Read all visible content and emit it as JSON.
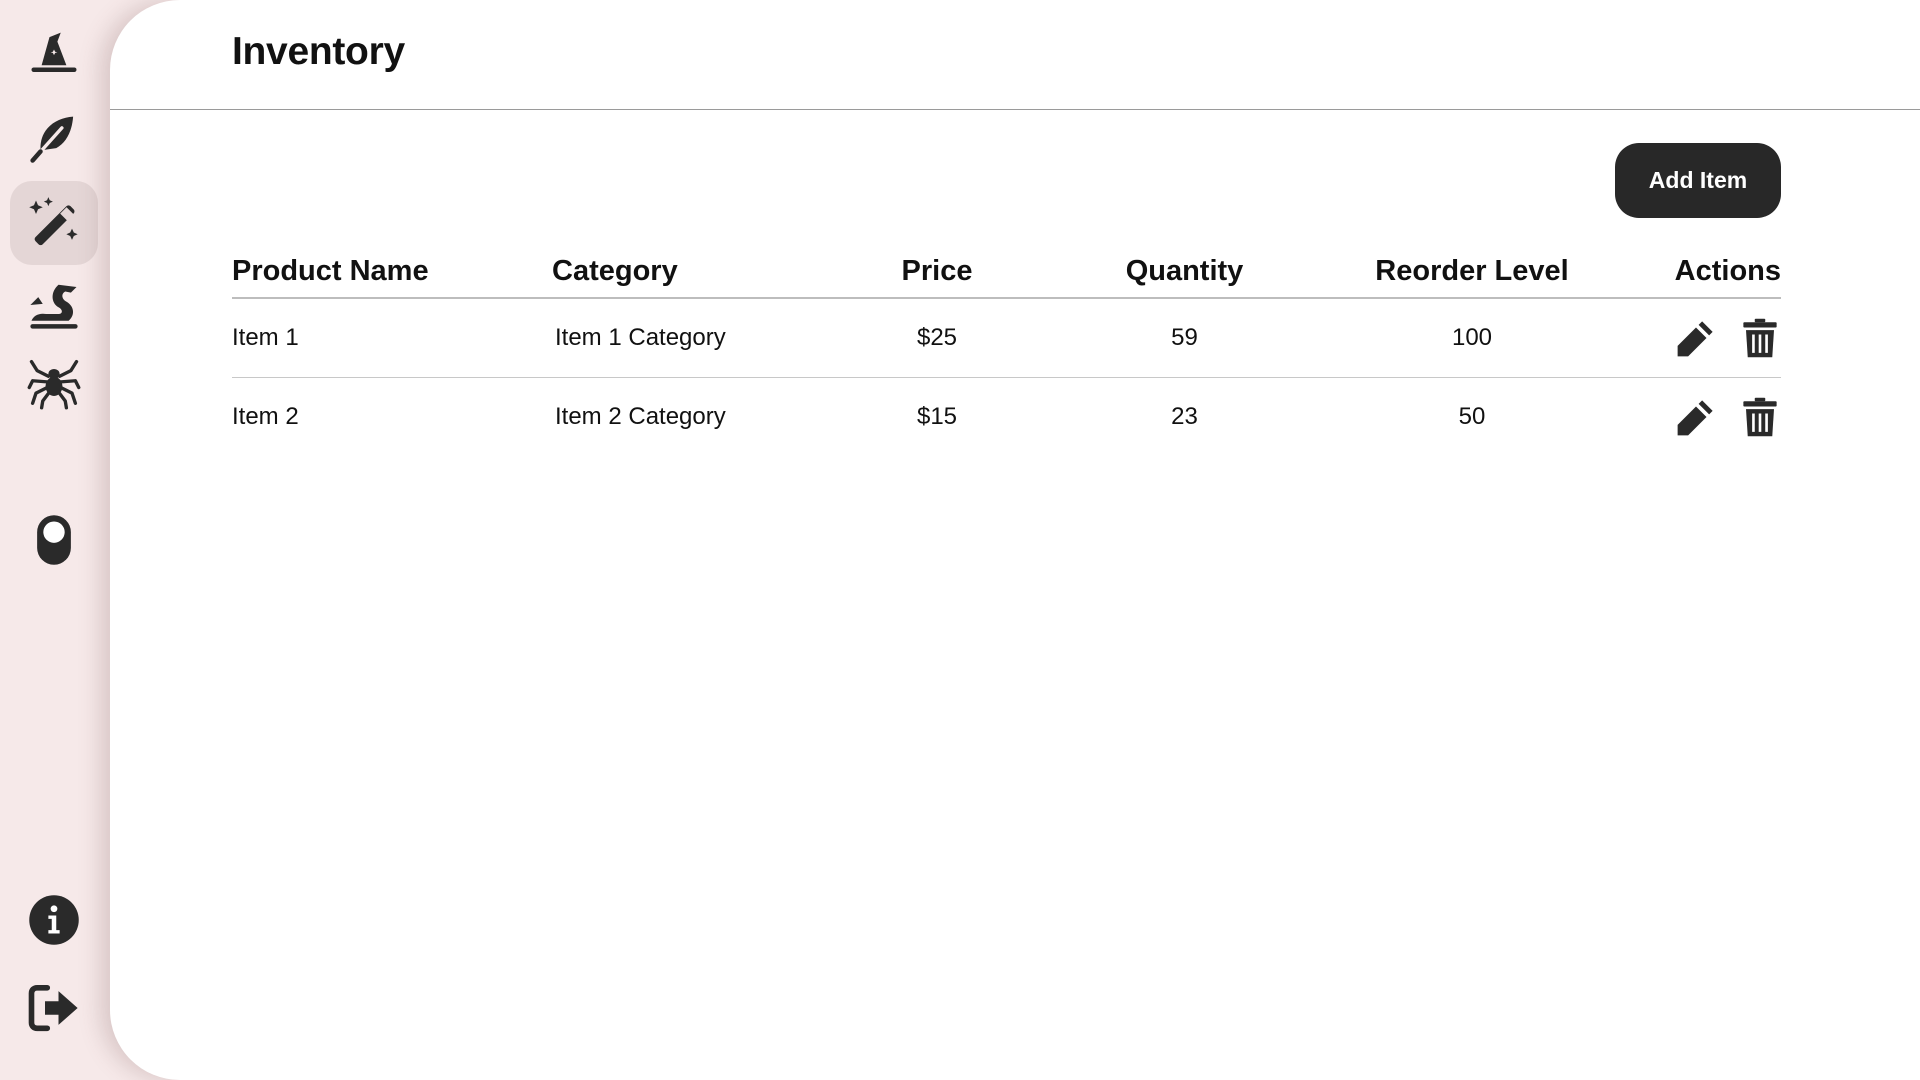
{
  "sidebar": {
    "items": [
      {
        "icon": "wizard-hat-icon",
        "active": false
      },
      {
        "icon": "feather-icon",
        "active": false
      },
      {
        "icon": "magic-wand-sparkles-icon",
        "active": true
      },
      {
        "icon": "dragon-icon",
        "active": false
      },
      {
        "icon": "spider-icon",
        "active": false
      }
    ],
    "toggle_icon": "toggle-icon",
    "info_icon": "info-icon",
    "logout_icon": "logout-icon"
  },
  "header": {
    "title": "Inventory"
  },
  "toolbar": {
    "add_label": "Add Item"
  },
  "table": {
    "columns": [
      "Product Name",
      "Category",
      "Price",
      "Quantity",
      "Reorder Level",
      "Actions"
    ],
    "rows": [
      {
        "name": "Item 1",
        "category": "Item 1 Category",
        "price": "$25",
        "quantity": "59",
        "reorder": "100"
      },
      {
        "name": "Item 2",
        "category": "Item 2 Category",
        "price": "$15",
        "quantity": "23",
        "reorder": "50"
      }
    ],
    "row_actions": [
      "edit-icon",
      "delete-icon"
    ]
  },
  "colors": {
    "sidebar_bg": "#f6e9e9",
    "active_item_bg": "#e4d6d6",
    "icon": "#2a2a2a",
    "button_bg": "#282828",
    "button_text": "#ffffff",
    "divider": "#9a9a9a"
  }
}
